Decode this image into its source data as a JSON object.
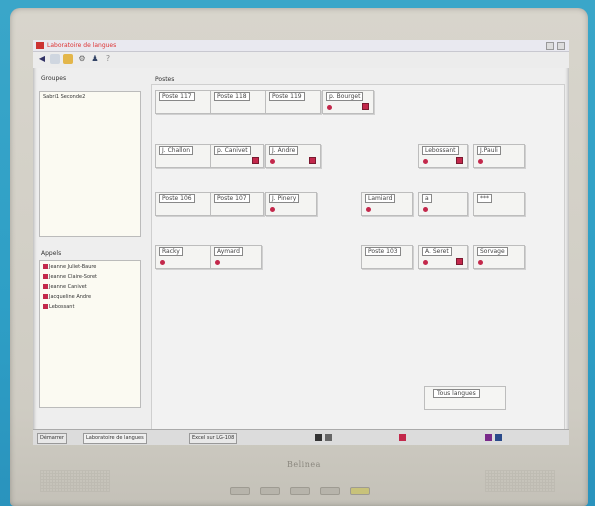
{
  "window": {
    "title": "Laboratoire de langues"
  },
  "groups_panel": {
    "label": "Groupes",
    "items": [
      "Sabri1 Seconde2"
    ]
  },
  "students_panel": {
    "label": "Appels",
    "items": [
      "Jeanne Juliet-Baure",
      "Jeanne Claire-Soret",
      "Jeanne Canivet",
      "Jacqueline Andre",
      "Lebossant"
    ]
  },
  "main_panel": {
    "label": "Postes"
  },
  "stations": [
    {
      "label": "Poste 117",
      "dot": false,
      "sq": false
    },
    {
      "label": "Poste 118",
      "dot": false,
      "sq": false
    },
    {
      "label": "Poste 119",
      "dot": false,
      "sq": false
    },
    {
      "label": "p. Bourget",
      "dot": true,
      "sq": true
    },
    {
      "label": "J. Challon",
      "dot": false,
      "sq": false
    },
    {
      "label": "p. Canivet",
      "dot": false,
      "sq": true
    },
    {
      "label": "J. Andre",
      "dot": true,
      "sq": true
    },
    {
      "label": "Lebossant",
      "dot": true,
      "sq": true
    },
    {
      "label": "J.Pauli",
      "dot": true,
      "sq": false
    },
    {
      "label": "Poste 106",
      "dot": false,
      "sq": false
    },
    {
      "label": "Poste 107",
      "dot": false,
      "sq": false
    },
    {
      "label": "J. Pinery",
      "dot": true,
      "sq": false
    },
    {
      "label": "Lamiard",
      "dot": true,
      "sq": false
    },
    {
      "label": "a",
      "dot": true,
      "sq": false
    },
    {
      "label": "***",
      "dot": false,
      "sq": false
    },
    {
      "label": "Racky",
      "dot": true,
      "sq": false
    },
    {
      "label": "Aymard",
      "dot": true,
      "sq": false
    },
    {
      "label": "Poste 103",
      "dot": false,
      "sq": false
    },
    {
      "label": "A. Seret",
      "dot": true,
      "sq": true
    },
    {
      "label": "Sorvage",
      "dot": true,
      "sq": false
    }
  ],
  "action_button": {
    "label": "Tous langues"
  },
  "taskbar": {
    "start": "Démarrer",
    "tasks": [
      "Laboratoire de langues",
      "Excel sur LG-108"
    ]
  },
  "monitor": {
    "brand": "Belinea"
  },
  "colors": {
    "accent": "#c3284b",
    "background": "#2e9fc6"
  },
  "icons": [
    "app-icon",
    "new-icon",
    "open-icon",
    "folder-icon",
    "settings-icon",
    "user-icon",
    "help-icon"
  ]
}
